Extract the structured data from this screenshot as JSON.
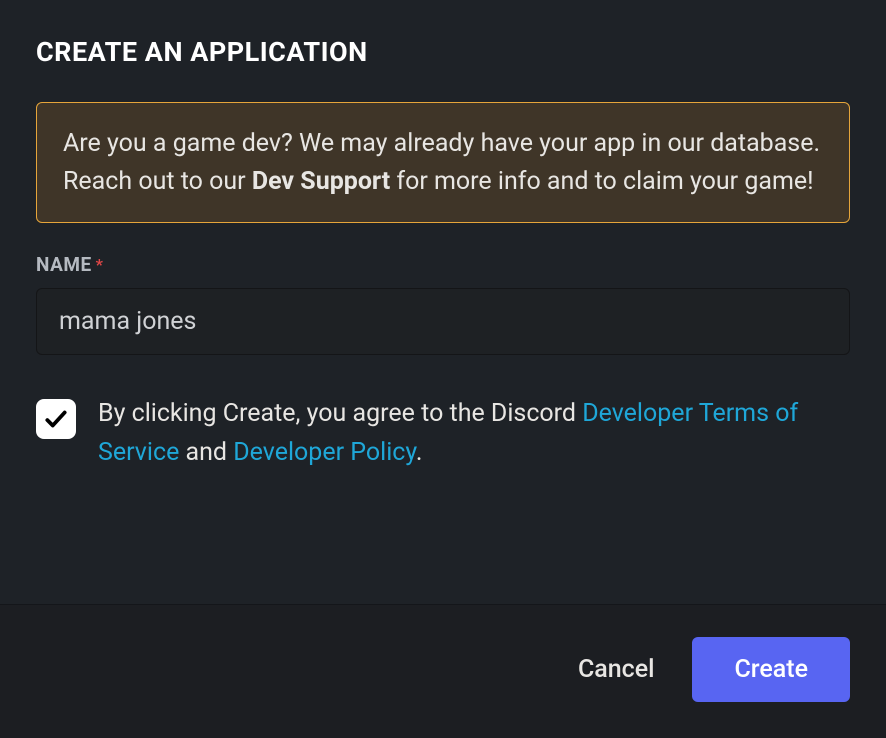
{
  "modal": {
    "title": "CREATE AN APPLICATION",
    "info_box": {
      "text_before_bold": "Are you a game dev? We may already have your app in our database. Reach out to our ",
      "bold_text": "Dev Support",
      "text_after_bold": " for more info and to claim your game!"
    },
    "name_field": {
      "label": "NAME",
      "required_indicator": "*",
      "value": "mama jones"
    },
    "agreement": {
      "checked": true,
      "text_prefix": "By clicking Create, you agree to the Discord ",
      "link_tos": "Developer Terms of Service",
      "text_middle": " and ",
      "link_policy": "Developer Policy",
      "text_suffix": "."
    },
    "buttons": {
      "cancel": "Cancel",
      "create": "Create"
    }
  }
}
